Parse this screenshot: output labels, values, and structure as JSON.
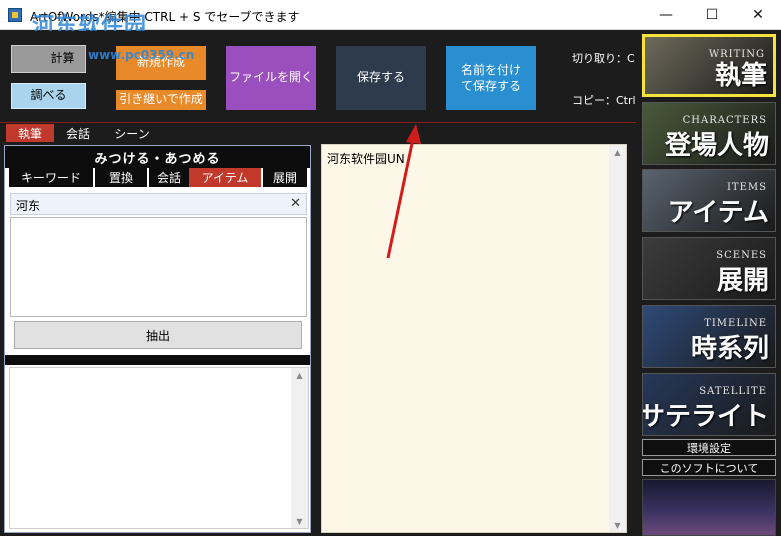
{
  "titlebar": {
    "title": "ArtOfWords*編集中  CTRL + S でセーブできます",
    "watermark": "河东软件园",
    "watermark_url": "www.pc0359.cn",
    "minimize": "—",
    "maximize": "☐",
    "close": "✕"
  },
  "toolbar": {
    "calc_label": "計算",
    "lookup_label": "調べる",
    "new_label": "新規作成",
    "inherit_label": "引き継いで作成",
    "open_label": "ファイルを開く",
    "save_label": "保存する",
    "saveas_label": "名前を付けて保存する",
    "cut_hint": "切り取り：C",
    "copy_hint": "コピー：Ctrl"
  },
  "main_tabs": [
    {
      "label": "執筆",
      "active": true
    },
    {
      "label": "会話",
      "active": false
    },
    {
      "label": "シーン",
      "active": false
    }
  ],
  "left_panel": {
    "header": "みつける・あつめる",
    "subtabs": [
      {
        "label": "キーワード",
        "active": false
      },
      {
        "label": "置換",
        "active": false
      },
      {
        "label": "会話",
        "active": false
      },
      {
        "label": "アイテム",
        "active": true
      },
      {
        "label": "展開",
        "active": false
      }
    ],
    "search_value": "河东",
    "search_clear": "✕",
    "extract_label": "抽出"
  },
  "editor": {
    "content": "河东软件园UN"
  },
  "sidebar": {
    "items": [
      {
        "en": "WRITING",
        "ja": "執筆",
        "active": true,
        "bg": "#6e6a5a"
      },
      {
        "en": "CHARACTERS",
        "ja": "登場人物",
        "active": false,
        "bg": "#4a5a3a"
      },
      {
        "en": "ITEMS",
        "ja": "アイテム",
        "active": false,
        "bg": "#5a6470"
      },
      {
        "en": "SCENES",
        "ja": "展開",
        "active": false,
        "bg": "#3c3c3c"
      },
      {
        "en": "TIMELINE",
        "ja": "時系列",
        "active": false,
        "bg": "#2e4a78"
      },
      {
        "en": "SATELLITE",
        "ja": "サテライト",
        "active": false,
        "bg": "#26385a"
      }
    ],
    "settings_label": "環境設定",
    "about_label": "このソフトについて"
  },
  "colors": {
    "accent_red": "#c0392b",
    "highlight_yellow": "#f6e23d",
    "editor_bg": "#fdf7e7"
  }
}
